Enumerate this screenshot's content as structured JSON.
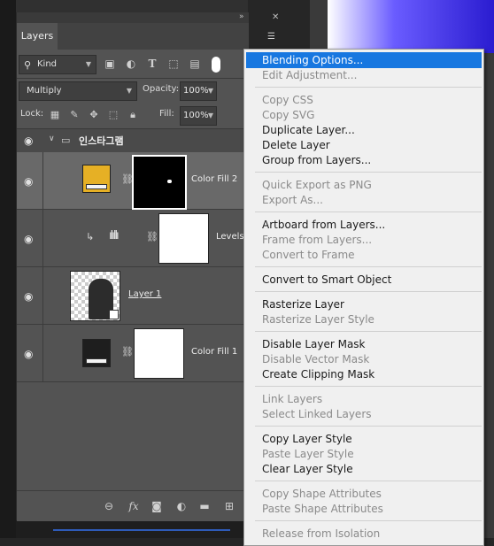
{
  "layers_panel": {
    "tab_label": "Layers",
    "filter_kind": "Kind",
    "blend_mode": "Multiply",
    "opacity_label": "Opacity:",
    "opacity_value": "100%",
    "lock_label": "Lock:",
    "fill_label": "Fill:",
    "fill_value": "100%",
    "group": {
      "name": "인스타그램"
    },
    "layers": [
      {
        "name": "Color Fill 2",
        "swatch_color": "#e6b025",
        "selected": true
      },
      {
        "name": "Levels"
      },
      {
        "name": "Layer 1"
      },
      {
        "name": "Color Fill 1",
        "swatch_color": "#1e1e1e"
      }
    ]
  },
  "context_menu": {
    "items": [
      {
        "label": "Blending Options...",
        "enabled": true,
        "highlighted": true
      },
      {
        "label": "Edit Adjustment...",
        "enabled": false
      },
      {
        "label": "Copy CSS",
        "enabled": false
      },
      {
        "label": "Copy SVG",
        "enabled": false
      },
      {
        "label": "Duplicate Layer...",
        "enabled": true
      },
      {
        "label": "Delete Layer",
        "enabled": true
      },
      {
        "label": "Group from Layers...",
        "enabled": true
      },
      {
        "label": "Quick Export as PNG",
        "enabled": false
      },
      {
        "label": "Export As...",
        "enabled": false
      },
      {
        "label": "Artboard from Layers...",
        "enabled": true
      },
      {
        "label": "Frame from Layers...",
        "enabled": false
      },
      {
        "label": "Convert to Frame",
        "enabled": false
      },
      {
        "label": "Convert to Smart Object",
        "enabled": true
      },
      {
        "label": "Rasterize Layer",
        "enabled": true
      },
      {
        "label": "Rasterize Layer Style",
        "enabled": false
      },
      {
        "label": "Disable Layer Mask",
        "enabled": true
      },
      {
        "label": "Disable Vector Mask",
        "enabled": false
      },
      {
        "label": "Create Clipping Mask",
        "enabled": true
      },
      {
        "label": "Link Layers",
        "enabled": false
      },
      {
        "label": "Select Linked Layers",
        "enabled": false
      },
      {
        "label": "Copy Layer Style",
        "enabled": true
      },
      {
        "label": "Paste Layer Style",
        "enabled": false
      },
      {
        "label": "Clear Layer Style",
        "enabled": true
      },
      {
        "label": "Copy Shape Attributes",
        "enabled": false
      },
      {
        "label": "Paste Shape Attributes",
        "enabled": false
      },
      {
        "label": "Release from Isolation",
        "enabled": false
      }
    ]
  },
  "colors": {
    "menu_highlight": "#1777e0",
    "panel_bg": "#535353",
    "selected_layer_bg": "#696969"
  }
}
